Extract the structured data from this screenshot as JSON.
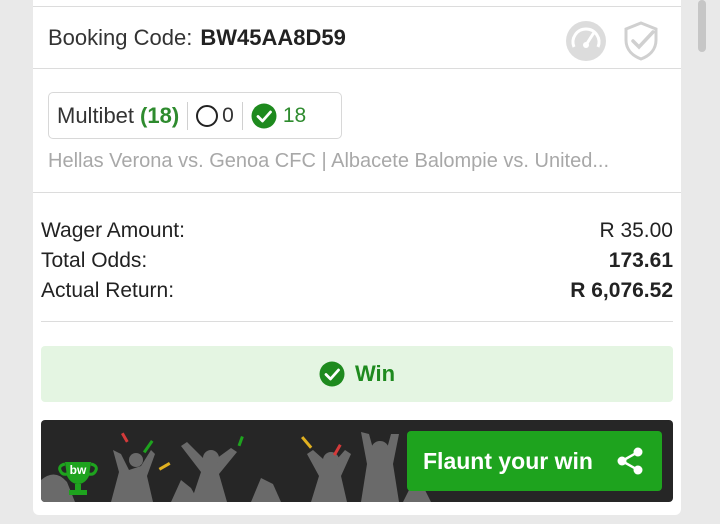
{
  "booking": {
    "label": "Booking Code:",
    "code": "BW45AA8D59",
    "icons": [
      "speedometer-icon",
      "shield-check-icon"
    ]
  },
  "bet": {
    "type_label": "Multibet",
    "legs": "(18)",
    "pending_count": "0",
    "won_count": "18",
    "matches": "Hellas Verona vs. Genoa CFC | Albacete Balompie vs. United..."
  },
  "summary": {
    "rows": [
      {
        "key": "Wager Amount:",
        "value": "R 35.00"
      },
      {
        "key": "Total Odds:",
        "value": "173.61"
      },
      {
        "key": "Actual Return:",
        "value": "R 6,076.52"
      }
    ]
  },
  "result": {
    "label": "Win",
    "icon": "check-circle-icon"
  },
  "banner": {
    "logo_text": "bw",
    "button_label": "Flaunt your win",
    "button_icon": "share-icon"
  },
  "colors": {
    "win_green": "#1e8a1e",
    "button_green": "#1ea31e",
    "win_bg": "#e4f5e2",
    "banner_bg": "#262626"
  }
}
